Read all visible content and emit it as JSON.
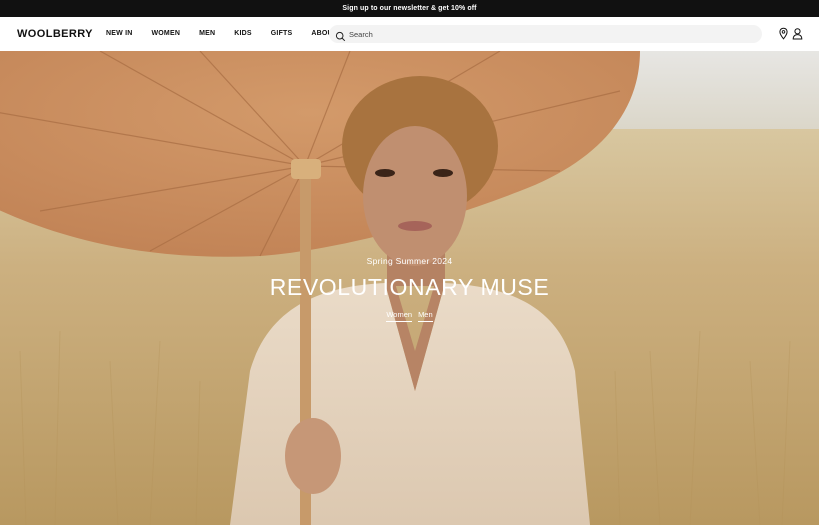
{
  "announcement": {
    "text": "Sign up to our newsletter & get 10% off"
  },
  "header": {
    "logo": "WOOLBERRY",
    "nav": [
      "NEW IN",
      "WOMEN",
      "MEN",
      "KIDS",
      "GIFTS",
      "ABOUT"
    ],
    "search": {
      "placeholder": "Search"
    },
    "icons": [
      "location-pin-icon",
      "user-icon"
    ]
  },
  "hero": {
    "subtitle": "Spring Summer 2024",
    "title": "REVOLUTIONARY MUSE",
    "links": [
      "Women",
      "Men"
    ]
  }
}
